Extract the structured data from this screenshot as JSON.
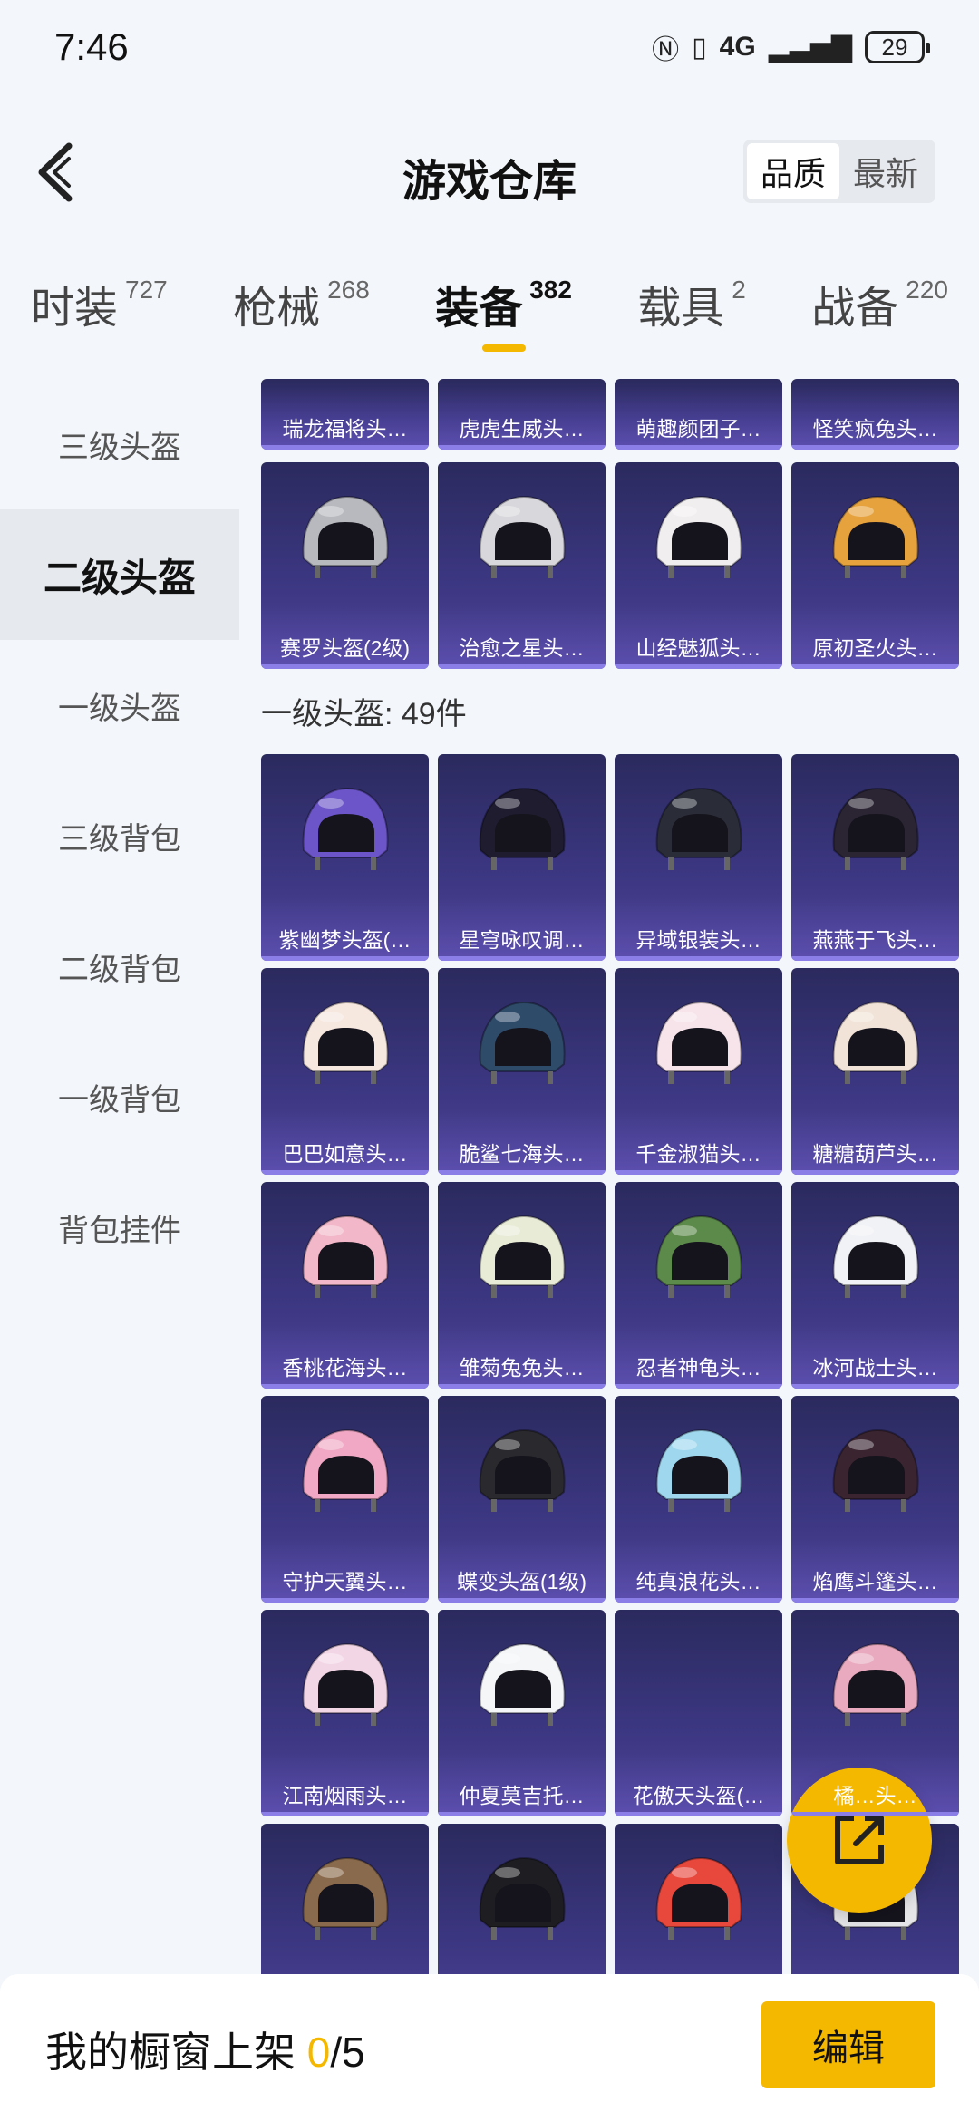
{
  "status_bar": {
    "time": "7:46",
    "network": "4G",
    "battery": "29"
  },
  "header": {
    "title": "游戏仓库",
    "sort_options": [
      "品质",
      "最新"
    ]
  },
  "tabs": [
    {
      "label": "时装",
      "count": "727"
    },
    {
      "label": "枪械",
      "count": "268"
    },
    {
      "label": "装备",
      "count": "382"
    },
    {
      "label": "载具",
      "count": "2"
    },
    {
      "label": "战备",
      "count": "220"
    }
  ],
  "sidebar": {
    "items": [
      "三级头盔",
      "二级头盔",
      "一级头盔",
      "三级背包",
      "二级背包",
      "一级背包",
      "背包挂件"
    ],
    "active": "二级头盔"
  },
  "grid": {
    "row0": [
      "瑞龙福将头…",
      "虎虎生威头…",
      "萌趣颜团子…",
      "怪笑疯兔头…"
    ],
    "row1": [
      "赛罗头盔(2级)",
      "治愈之星头…",
      "山经魅狐头…",
      "原初圣火头…"
    ],
    "section_label": "一级头盔: 49件",
    "row2": [
      "紫幽梦头盔(…",
      "星穹咏叹调…",
      "异域银装头…",
      "燕燕于飞头…"
    ],
    "row3": [
      "巴巴如意头…",
      "脆鲨七海头…",
      "千金淑猫头…",
      "糖糖葫芦头…"
    ],
    "row4": [
      "香桃花海头…",
      "雏菊兔兔头…",
      "忍者神龟头…",
      "冰河战士头…"
    ],
    "row5": [
      "守护天翼头…",
      "蝶变头盔(1级)",
      "纯真浪花头…",
      "焰鹰斗篷头…"
    ],
    "row6": [
      "江南烟雨头…",
      "仲夏莫吉托…",
      "花傲天头盔(…",
      "橘…头…"
    ]
  },
  "helmet_colors": {
    "row1": [
      "#b7b9bf",
      "#d8d8dc",
      "#f1eef0",
      "#e6a23c"
    ],
    "row2": [
      "#6b55c8",
      "#1e1c2e",
      "#2a2d38",
      "#2a2433"
    ],
    "row3": [
      "#f6e7df",
      "#2f4b6a",
      "#f6e4ea",
      "#f2e3d8"
    ],
    "row4": [
      "#f2b7c8",
      "#e8ecd7",
      "#5c8a4a",
      "#f1f2f6"
    ],
    "row5": [
      "#f0a8c4",
      "#2a2a2e",
      "#9fd8ee",
      "#3a2430"
    ],
    "row6": [
      "#f3d6e6",
      "#f4f6f8",
      "",
      "#e9a9be"
    ],
    "row7": [
      "#8a6a4c",
      "#1e1e22",
      "#e8483c",
      "#e5e5e8"
    ]
  },
  "bottom_bar": {
    "label": "我的橱窗上架 ",
    "count_current": "0",
    "count_total": "/5",
    "edit": "编辑"
  }
}
